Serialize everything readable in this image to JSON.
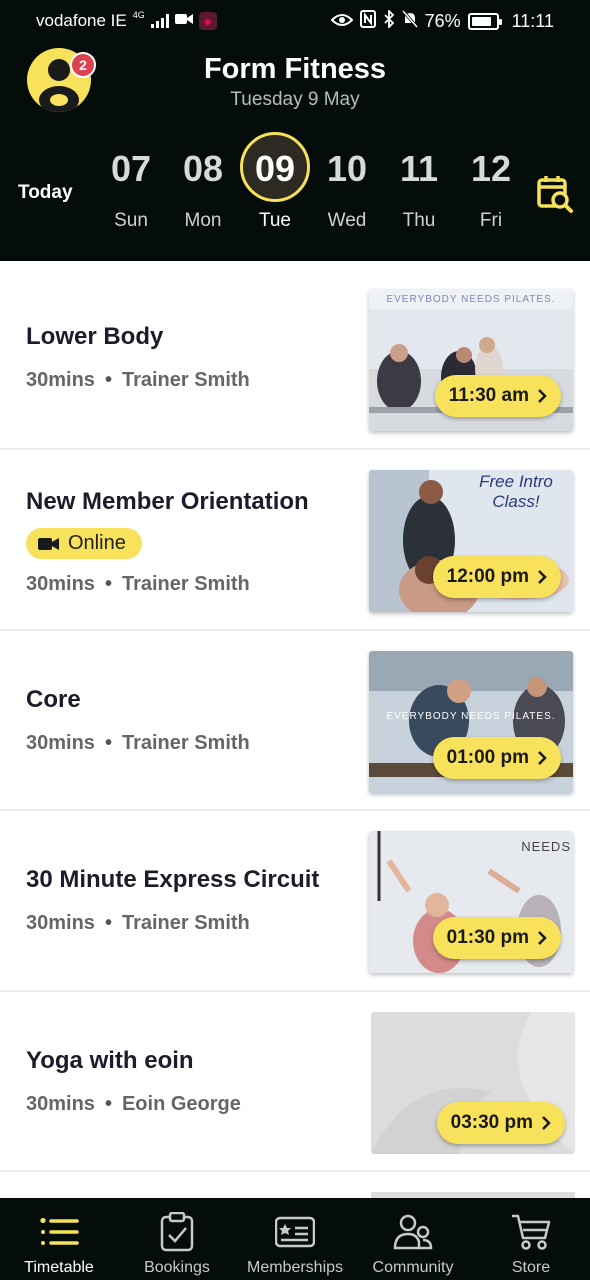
{
  "status_bar": {
    "carrier": "vodafone IE",
    "network": "4G",
    "battery": "76%",
    "time": "11:11"
  },
  "header": {
    "title": "Form Fitness",
    "date": "Tuesday 9 May",
    "notification_count": "2",
    "today_label": "Today"
  },
  "days": [
    {
      "num": "07",
      "dow": "Sun",
      "selected": false
    },
    {
      "num": "08",
      "dow": "Mon",
      "selected": false
    },
    {
      "num": "09",
      "dow": "Tue",
      "selected": true
    },
    {
      "num": "10",
      "dow": "Wed",
      "selected": false
    },
    {
      "num": "11",
      "dow": "Thu",
      "selected": false
    },
    {
      "num": "12",
      "dow": "Fri",
      "selected": false
    }
  ],
  "classes": [
    {
      "title": "Lower Body",
      "duration": "30mins",
      "trainer": "Trainer Smith",
      "time": "11:30 am",
      "image_text": "EVERYBODY NEEDS PILATES."
    },
    {
      "title": "New Member Orientation",
      "online_label": "Online",
      "duration": "30mins",
      "trainer": "Trainer Smith",
      "time": "12:00 pm",
      "image_text": "Free Intro Class!"
    },
    {
      "title": "Core",
      "duration": "30mins",
      "trainer": "Trainer Smith",
      "time": "01:00 pm",
      "image_text": "EVERYBODY NEEDS PILATES."
    },
    {
      "title": "30 Minute Express Circuit",
      "duration": "30mins",
      "trainer": "Trainer Smith",
      "time": "01:30 pm",
      "image_text": "NEEDS"
    },
    {
      "title": "Yoga with eoin",
      "duration": "30mins",
      "trainer": "Eoin George",
      "time": "03:30 pm"
    }
  ],
  "separator": "•",
  "bottom_nav": [
    {
      "label": "Timetable",
      "icon": "timetable-icon",
      "active": true
    },
    {
      "label": "Bookings",
      "icon": "bookings-icon",
      "active": false
    },
    {
      "label": "Memberships",
      "icon": "memberships-icon",
      "active": false
    },
    {
      "label": "Community",
      "icon": "community-icon",
      "active": false
    },
    {
      "label": "Store",
      "icon": "store-cart-icon",
      "active": false
    }
  ],
  "colors": {
    "accent_yellow": "#f8e15b",
    "header_bg": "#040d0a",
    "badge_red": "#d9434f"
  }
}
